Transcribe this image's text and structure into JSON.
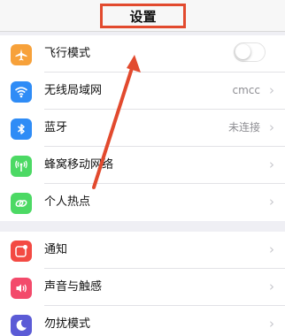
{
  "nav": {
    "title": "设置"
  },
  "colors": {
    "accent_red": "#e24a2e",
    "airplane": "#f7a13a",
    "wifi": "#2f8cf6",
    "bluetooth": "#2f8cf6",
    "cellular": "#4cd964",
    "hotspot": "#4cd964",
    "notifications": "#f34a43",
    "sounds": "#f34a6b",
    "dnd": "#5b5bd6"
  },
  "group1": {
    "airplane": {
      "label": "飞行模式",
      "icon": "airplane-icon",
      "toggle_on": false
    },
    "wifi": {
      "label": "无线局域网",
      "value": "cmcc",
      "icon": "wifi-icon"
    },
    "bluetooth": {
      "label": "蓝牙",
      "value": "未连接",
      "icon": "bluetooth-icon"
    },
    "cellular": {
      "label": "蜂窝移动网络",
      "icon": "antenna-icon"
    },
    "hotspot": {
      "label": "个人热点",
      "icon": "link-icon"
    }
  },
  "group2": {
    "notifications": {
      "label": "通知",
      "icon": "notification-icon"
    },
    "sounds": {
      "label": "声音与触感",
      "icon": "speaker-icon"
    },
    "dnd": {
      "label": "勿扰模式",
      "icon": "moon-icon"
    }
  },
  "chevron": "›"
}
